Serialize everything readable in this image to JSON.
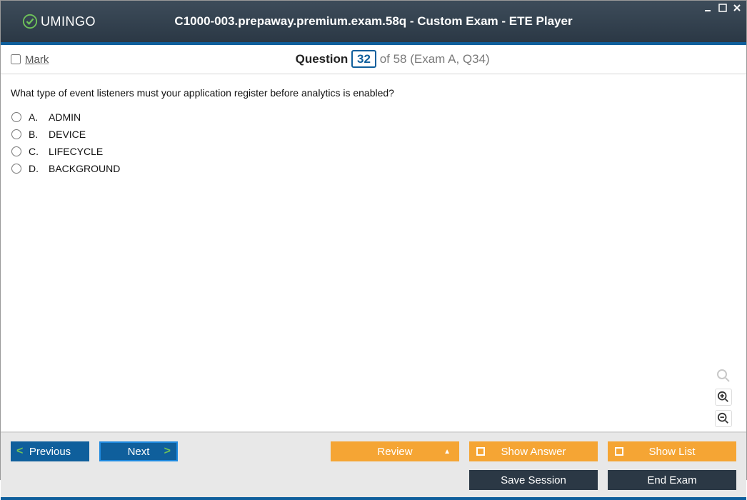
{
  "titlebar": {
    "logo_text": "UMINGO",
    "title": "C1000-003.prepaway.premium.exam.58q - Custom Exam - ETE Player"
  },
  "header": {
    "mark_label": "Mark",
    "question_word": "Question",
    "current": "32",
    "of_total": "of 58 (Exam A, Q34)"
  },
  "question": {
    "text": "What type of event listeners must your application register before analytics is enabled?",
    "options": [
      {
        "letter": "A.",
        "text": "ADMIN"
      },
      {
        "letter": "B.",
        "text": "DEVICE"
      },
      {
        "letter": "C.",
        "text": "LIFECYCLE"
      },
      {
        "letter": "D.",
        "text": "BACKGROUND"
      }
    ]
  },
  "footer": {
    "previous": "Previous",
    "next": "Next",
    "review": "Review",
    "show_answer": "Show Answer",
    "show_list": "Show List",
    "save_session": "Save Session",
    "end_exam": "End Exam"
  }
}
